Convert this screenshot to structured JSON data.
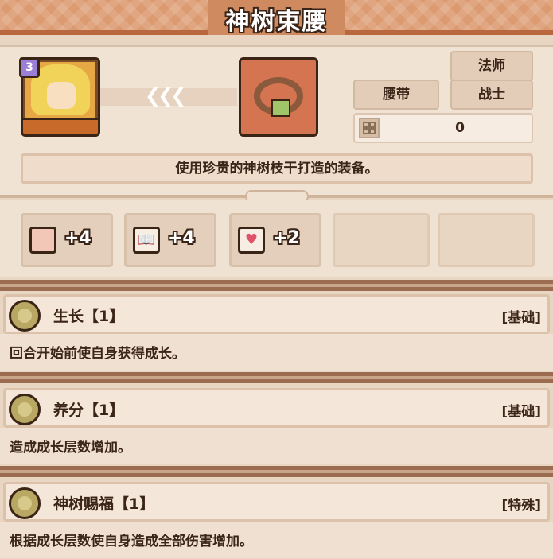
{
  "title": "神树束腰",
  "hero": {
    "level": "3",
    "arrows": "❮❮❮"
  },
  "tags": {
    "class_1": "法师",
    "slot": "腰带",
    "class_2": "战士"
  },
  "count": {
    "value": "0"
  },
  "description": "使用珍贵的神树枝干打造的装备。",
  "stats": [
    {
      "icon": "fist-icon",
      "value": "+4"
    },
    {
      "icon": "book-icon",
      "value": "+4"
    },
    {
      "icon": "heart-icon",
      "value": "+2"
    }
  ],
  "skills": [
    {
      "name": "生长【1】",
      "type": "[基础]",
      "desc": "回合开始前使自身获得成长。"
    },
    {
      "name": "养分【1】",
      "type": "[基础]",
      "desc": "造成成长层数增加。"
    },
    {
      "name": "神树赐福【1】",
      "type": "[特殊]",
      "desc": "根据成长层数使自身造成全部伤害增加。"
    }
  ]
}
